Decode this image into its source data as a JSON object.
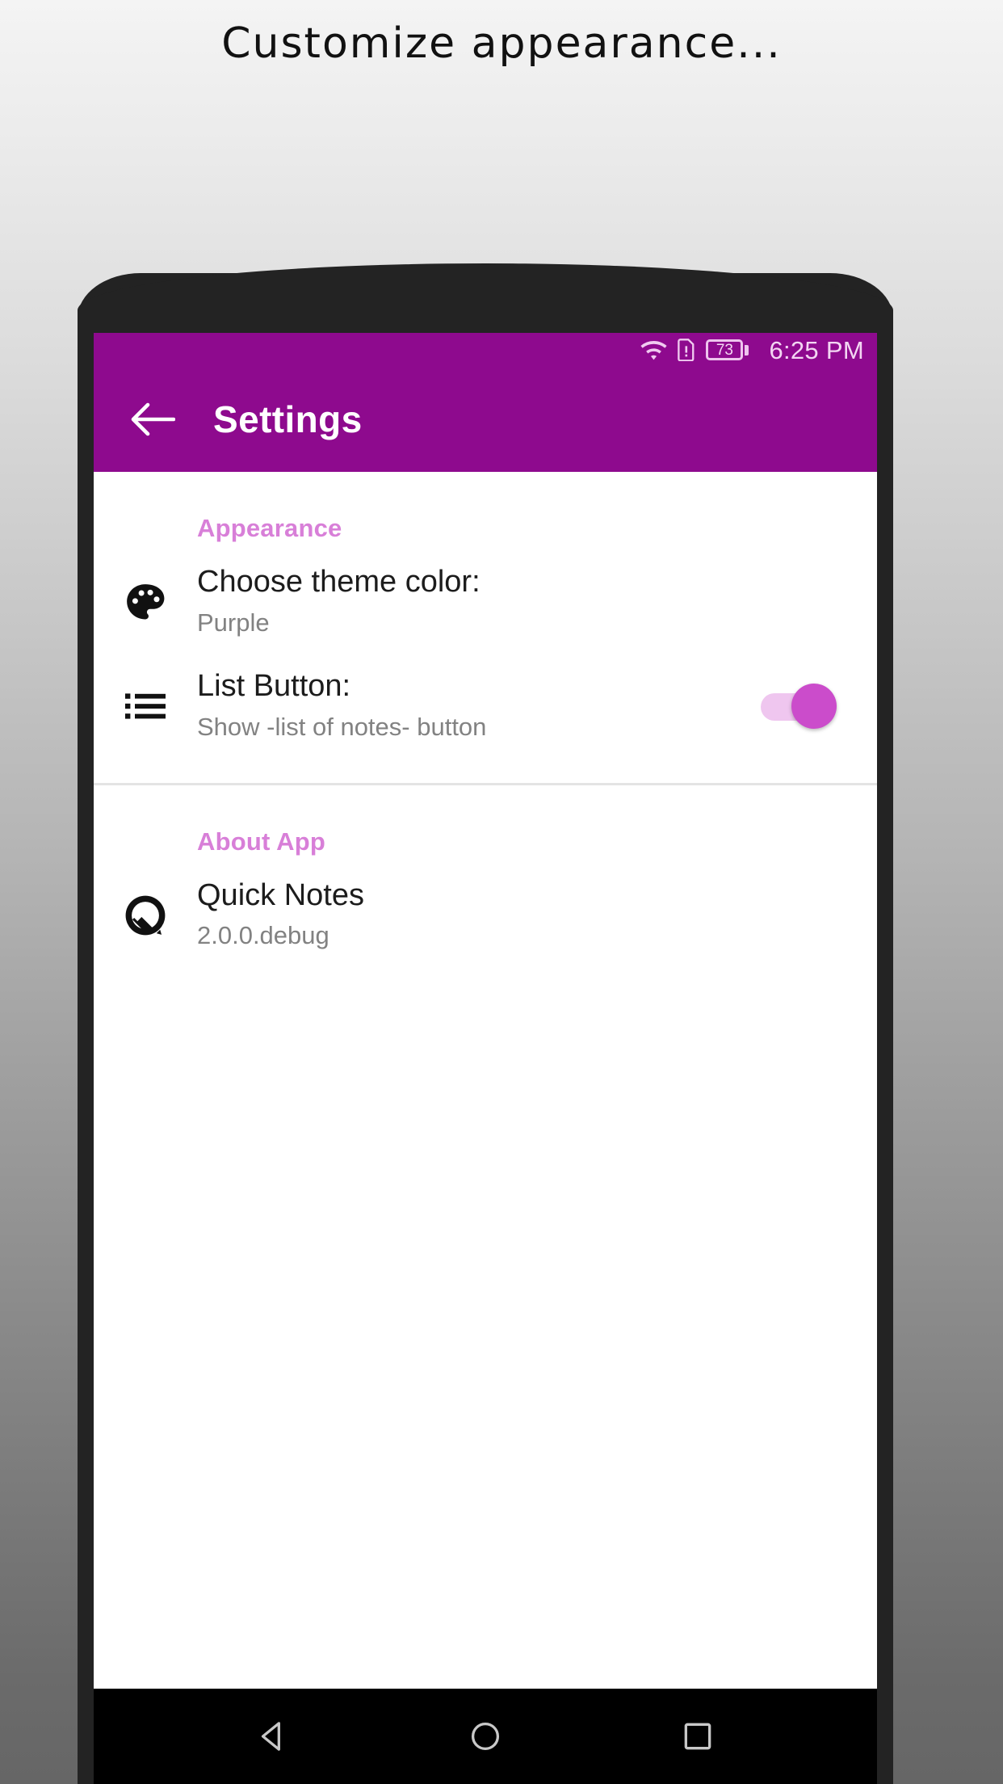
{
  "caption": "Customize appearance...",
  "theme": {
    "accent_hex": "#8e0a8e",
    "section_header_hex": "#d87fd8",
    "switch_thumb_hex": "#cb4ccb",
    "switch_track_hex": "#efc6ef"
  },
  "status_bar": {
    "wifi_icon": "wifi-icon",
    "alert_doc_icon": "document-alert-icon",
    "battery_level": "73",
    "time": "6:25 PM"
  },
  "toolbar": {
    "back_icon": "back-arrow-icon",
    "title": "Settings"
  },
  "sections": [
    {
      "header": "Appearance",
      "rows": [
        {
          "icon": "palette-icon",
          "title": "Choose theme color:",
          "subtitle": "Purple",
          "control": "none"
        },
        {
          "icon": "list-icon",
          "title": "List Button:",
          "subtitle": "Show -list of notes- button",
          "control": "switch",
          "switch_on": true
        }
      ]
    },
    {
      "header": "About App",
      "rows": [
        {
          "icon": "quick-notes-app-icon",
          "title": "Quick Notes",
          "subtitle": "2.0.0.debug",
          "control": "none"
        }
      ]
    }
  ],
  "navigation_bar": {
    "back": "nav-back-icon",
    "home": "nav-home-icon",
    "recents": "nav-recents-icon"
  }
}
